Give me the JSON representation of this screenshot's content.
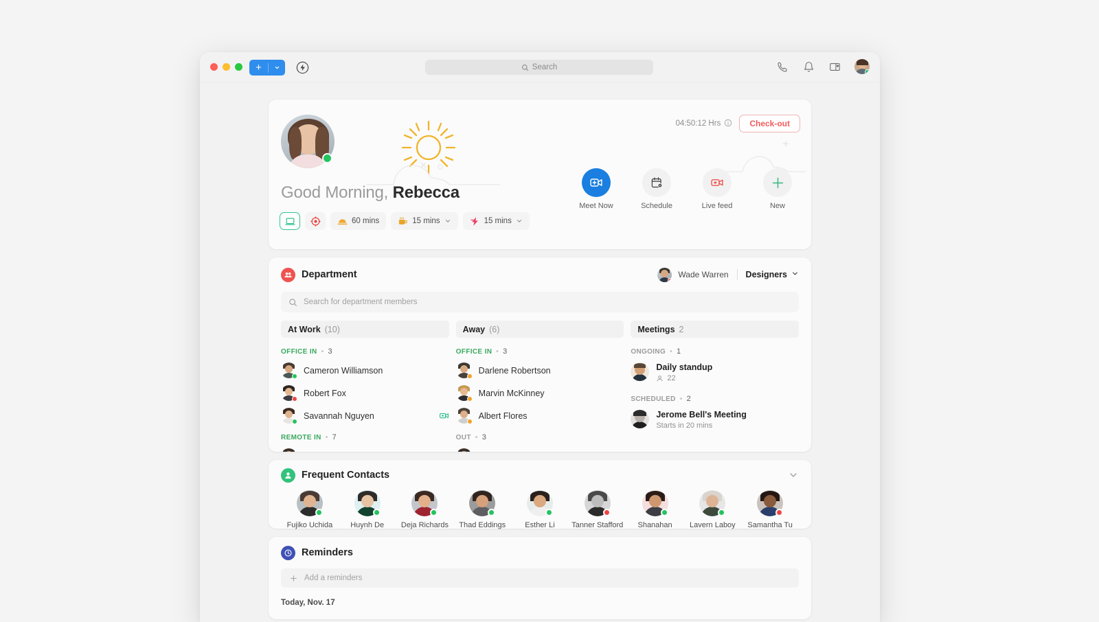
{
  "window": {
    "titlebar": {
      "new_button": {
        "plus": "+",
        "caret": "chevron-down"
      },
      "search_placeholder": "Search",
      "icons": [
        "phone-icon",
        "bell-icon",
        "panel-icon"
      ]
    }
  },
  "greeting": {
    "greet_prefix": "Good Morning, ",
    "user_name": "Rebecca",
    "hours": "04:50:12 Hrs",
    "checkout_label": "Check-out",
    "status_chips": [
      {
        "name": "desk-status",
        "icon": "laptop-icon",
        "label": "",
        "active": true,
        "caret": false
      },
      {
        "name": "focus-status",
        "icon": "target-icon",
        "label": "",
        "active": false,
        "caret": false
      },
      {
        "name": "lunch-status",
        "icon": "food-icon",
        "label": "60 mins",
        "active": false,
        "caret": false
      },
      {
        "name": "coffee-break-status",
        "icon": "coffee-icon",
        "label": "15 mins",
        "active": false,
        "caret": true
      },
      {
        "name": "quick-break-status",
        "icon": "bolt-icon",
        "label": "15 mins",
        "active": false,
        "caret": true
      }
    ],
    "quick_actions": [
      {
        "name": "meet-now",
        "label": "Meet Now",
        "icon": "video-add-icon",
        "primary": true
      },
      {
        "name": "schedule",
        "label": "Schedule",
        "icon": "calendar-settings-icon",
        "primary": false
      },
      {
        "name": "live-feed",
        "label": "Live feed",
        "icon": "live-video-icon",
        "primary": false
      },
      {
        "name": "new",
        "label": "New",
        "icon": "plus-icon",
        "primary": false
      }
    ]
  },
  "department": {
    "title": "Department",
    "owner_name": "Wade Warren",
    "team_name": "Designers",
    "search_placeholder": "Search for department members",
    "columns": [
      {
        "name": "at-work",
        "title": "At Work",
        "count": "(10)",
        "groups": [
          {
            "label": "OFFICE IN",
            "dot": "•",
            "count": "3",
            "color": "green",
            "people": [
              {
                "name": "Cameron Williamson",
                "status": "online",
                "action": null
              },
              {
                "name": "Robert Fox",
                "status": "busy",
                "action": null
              },
              {
                "name": "Savannah Nguyen",
                "status": "online",
                "action": "video-icon"
              }
            ]
          },
          {
            "label": "REMOTE IN",
            "dot": "•",
            "count": "7",
            "color": "green",
            "people": []
          }
        ]
      },
      {
        "name": "away",
        "title": "Away",
        "count": "(6)",
        "groups": [
          {
            "label": "OFFICE IN",
            "dot": "•",
            "count": "3",
            "color": "green",
            "people": [
              {
                "name": "Darlene Robertson",
                "status": "away",
                "action": null
              },
              {
                "name": "Marvin McKinney",
                "status": "away",
                "action": null
              },
              {
                "name": "Albert Flores",
                "status": "away",
                "action": null
              }
            ]
          },
          {
            "label": "OUT",
            "dot": "•",
            "count": "3",
            "color": "gray",
            "people": []
          }
        ]
      },
      {
        "name": "meetings",
        "title": "Meetings",
        "count": "2",
        "groups": [
          {
            "label": "ONGOING",
            "dot": "•",
            "count": "1",
            "color": "gray",
            "meetings": [
              {
                "title": "Daily standup",
                "sub": "22",
                "sub_icon": "person-icon"
              }
            ]
          },
          {
            "label": "SCHEDULED",
            "dot": "•",
            "count": "2",
            "color": "gray",
            "meetings": [
              {
                "title": "Jerome Bell's Meeting",
                "sub": "Starts in 20 mins",
                "sub_icon": null
              }
            ]
          }
        ]
      }
    ]
  },
  "frequent_contacts": {
    "title": "Frequent Contacts",
    "contacts": [
      {
        "name": "Fujiko Uchida",
        "status": "online",
        "skin": "#e0b391",
        "hair": "#4a3a33",
        "body": "#2c2c2c",
        "bg": "#b9bfc2"
      },
      {
        "name": "Huynh De",
        "status": "online",
        "skin": "#e8c3a3",
        "hair": "#2e2b28",
        "body": "#13432f",
        "bg": "#dff0f2"
      },
      {
        "name": "Deja Richards",
        "status": "online",
        "skin": "#e2b18c",
        "hair": "#3a2a22",
        "body": "#9e2431",
        "bg": "#c3c7cc"
      },
      {
        "name": "Thad Eddings",
        "status": "online",
        "skin": "#d6a07a",
        "hair": "#30241f",
        "body": "#5e5e62",
        "bg": "#9b9b9b"
      },
      {
        "name": "Esther Li",
        "status": "online",
        "skin": "#dba87f",
        "hair": "#2b211c",
        "body": "#efefef",
        "bg": "#e6ecea"
      },
      {
        "name": "Tanner Stafford",
        "status": "busy",
        "skin": "#bdbdbd",
        "hair": "#4a4a4a",
        "body": "#2b2b2b",
        "bg": "#d6d6d6"
      },
      {
        "name": "Shanahan",
        "status": "online",
        "skin": "#cf9770",
        "hair": "#2a1d18",
        "body": "#3d3d44",
        "bg": "#f4dede"
      },
      {
        "name": "Lavern Laboy",
        "status": "online",
        "skin": "#ddb496",
        "hair": "#d9d4cd",
        "body": "#3d4a3c",
        "bg": "#e6e6e6"
      },
      {
        "name": "Samantha Tu",
        "status": "busy",
        "skin": "#8a5a3c",
        "hair": "#241713",
        "body": "#2a3f6b",
        "bg": "#c9c2bd"
      }
    ]
  },
  "reminders": {
    "title": "Reminders",
    "add_placeholder": "Add a reminders",
    "date_label": "Today, Nov. 17"
  }
}
